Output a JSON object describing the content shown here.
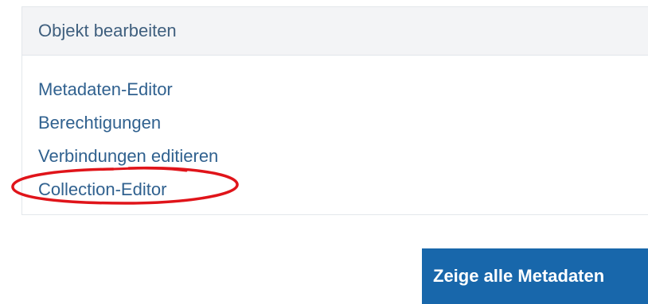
{
  "panel": {
    "title": "Objekt bearbeiten",
    "links": [
      {
        "label": "Metadaten-Editor"
      },
      {
        "label": "Berechtigungen"
      },
      {
        "label": "Verbindungen editieren"
      },
      {
        "label": "Collection-Editor",
        "highlighted": true
      }
    ]
  },
  "actions": {
    "show_all_metadata_label": "Zeige alle Metadaten"
  },
  "colors": {
    "link": "#30618f",
    "heading_text": "#3f5f7e",
    "heading_bg": "#f3f4f6",
    "button_bg": "#1867ab",
    "annotation": "#e0141a"
  }
}
